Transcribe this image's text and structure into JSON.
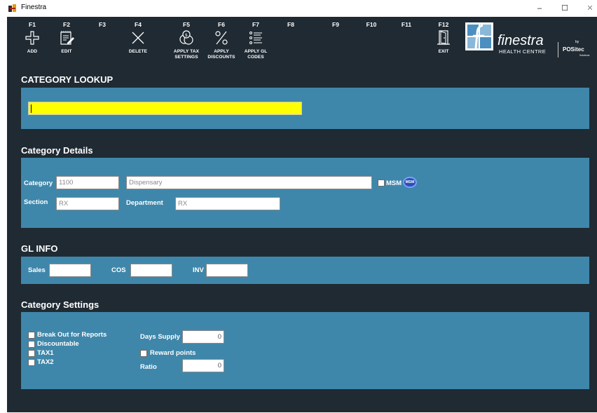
{
  "window": {
    "title": "Finestra",
    "minimize": "–",
    "maximize": "☐",
    "close": "✕"
  },
  "toolbar": {
    "f1": {
      "key": "F1",
      "label": "ADD",
      "label2": ""
    },
    "f2": {
      "key": "F2",
      "label": "EDIT",
      "label2": ""
    },
    "f3": {
      "key": "F3",
      "label": "",
      "label2": ""
    },
    "f4": {
      "key": "F4",
      "label": "DELETE",
      "label2": ""
    },
    "f5": {
      "key": "F5",
      "label": "APPLY TAX",
      "label2": "SETTINGS"
    },
    "f6": {
      "key": "F6",
      "label": "APPLY",
      "label2": "DISCOUNTS"
    },
    "f7": {
      "key": "F7",
      "label": "APPLY GL",
      "label2": "CODES"
    },
    "f8": {
      "key": "F8"
    },
    "f9": {
      "key": "F9"
    },
    "f10": {
      "key": "F10"
    },
    "f11": {
      "key": "F11"
    },
    "f12": {
      "key": "F12",
      "label": "EXIT",
      "label2": ""
    }
  },
  "logo": {
    "word": "finestra",
    "sub": "HEALTH CENTRE",
    "by": "by",
    "partner": "POSitec",
    "partner_sub": "Solutions"
  },
  "category_lookup": {
    "title": "CATEGORY LOOKUP",
    "value": ""
  },
  "category_details": {
    "title": "Category Details",
    "category_label": "Category",
    "category_value": "1100",
    "description_value": "Dispensary",
    "msm_label": "MSM",
    "msm_badge": "MSM",
    "section_label": "Section",
    "section_value": "RX",
    "department_label": "Department",
    "department_value": "RX"
  },
  "gl_info": {
    "title": "GL INFO",
    "sales_label": "Sales",
    "sales_value": "",
    "cos_label": "COS",
    "cos_value": "",
    "inv_label": "INV",
    "inv_value": ""
  },
  "category_settings": {
    "title": "Category Settings",
    "break_out_label": "Break Out for Reports",
    "discountable_label": "Discountable",
    "tax1_label": "TAX1",
    "tax2_label": "TAX2",
    "days_supply_label": "Days Supply",
    "days_supply_value": "0",
    "reward_points_label": "Reward points",
    "ratio_label": "Ratio",
    "ratio_value": "0"
  },
  "colors": {
    "app_background": "#1f2a33",
    "panel": "#3f87aa",
    "lookup_field": "#ffff00"
  }
}
